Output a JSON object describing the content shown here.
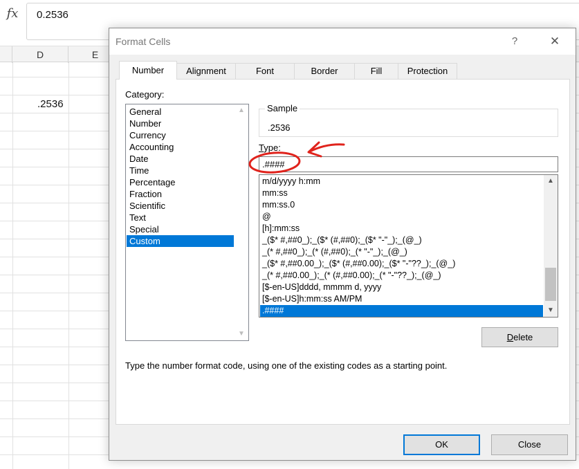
{
  "formula_bar": {
    "fx_label": "fx",
    "value": "0.2536"
  },
  "sheet": {
    "columns": [
      "D",
      "E"
    ],
    "cell_display": ".2536"
  },
  "dialog": {
    "title": "Format Cells",
    "help_label": "?",
    "close_label": "✕",
    "tabs": [
      {
        "label": "Number",
        "active": true
      },
      {
        "label": "Alignment",
        "active": false
      },
      {
        "label": "Font",
        "active": false
      },
      {
        "label": "Border",
        "active": false
      },
      {
        "label": "Fill",
        "active": false
      },
      {
        "label": "Protection",
        "active": false
      }
    ],
    "category_label": "Category:",
    "categories": [
      "General",
      "Number",
      "Currency",
      "Accounting",
      "Date",
      "Time",
      "Percentage",
      "Fraction",
      "Scientific",
      "Text",
      "Special",
      "Custom"
    ],
    "selected_category": "Custom",
    "sample_label": "Sample",
    "sample_value": ".2536",
    "type_label_prefix": "T",
    "type_label_rest": "ype:",
    "type_value": ".####",
    "format_codes": [
      "m/d/yyyy h:mm",
      "mm:ss",
      "mm:ss.0",
      "@",
      "[h]:mm:ss",
      "_($* #,##0_);_($* (#,##0);_($* \"-\"_);_(@_)",
      "_(* #,##0_);_(* (#,##0);_(* \"-\"_);_(@_)",
      "_($* #,##0.00_);_($* (#,##0.00);_($* \"-\"??_);_(@_)",
      "_(* #,##0.00_);_(* (#,##0.00);_(* \"-\"??_);_(@_)",
      "[$-en-US]dddd, mmmm d, yyyy",
      "[$-en-US]h:mm:ss AM/PM",
      ".####"
    ],
    "selected_format": ".####",
    "delete_label_prefix": "D",
    "delete_label_rest": "elete",
    "hint": "Type the number format code, using one of the existing codes as a starting point.",
    "ok_label": "OK",
    "cancel_label": "Close"
  },
  "colors": {
    "accent": "#0078d7",
    "annotation": "#e0231c"
  },
  "icons": {
    "up": "▲",
    "down": "▼"
  }
}
